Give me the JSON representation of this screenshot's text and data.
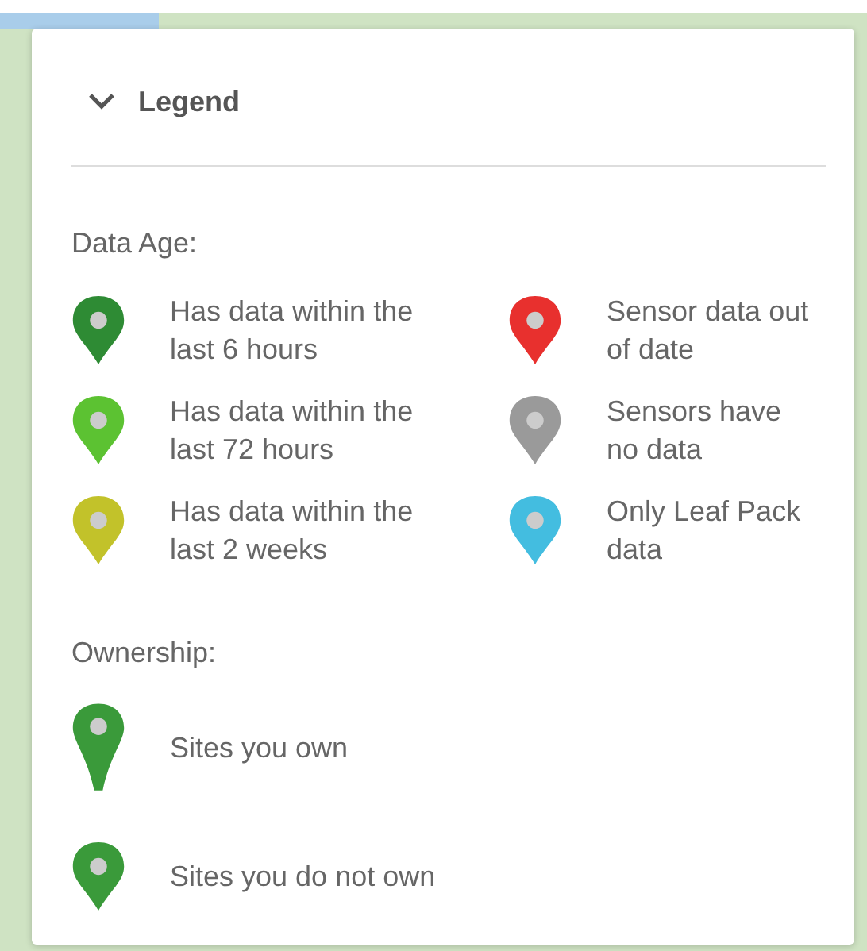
{
  "legend": {
    "title": "Legend",
    "expanded": true,
    "sections": [
      {
        "heading": "Data Age:",
        "items": [
          {
            "label": "Has data within the last 6 hours",
            "color": "#2e8b34",
            "kind": "short"
          },
          {
            "label": "Sensor data out of date",
            "color": "#e8302e",
            "kind": "short"
          },
          {
            "label": "Has data within the last 72 hours",
            "color": "#5cc232",
            "kind": "short"
          },
          {
            "label": "Sensors have no data",
            "color": "#9a9a9a",
            "kind": "short"
          },
          {
            "label": "Has data within the last 2 weeks",
            "color": "#c2c22a",
            "kind": "short"
          },
          {
            "label": "Only Leaf Pack data",
            "color": "#43bde0",
            "kind": "short"
          }
        ]
      },
      {
        "heading": "Ownership:",
        "items": [
          {
            "label": "Sites you own",
            "color": "#3a9a3a",
            "kind": "tall"
          },
          {
            "label": "Sites you do not own",
            "color": "#3a9a3a",
            "kind": "short"
          }
        ]
      }
    ]
  }
}
